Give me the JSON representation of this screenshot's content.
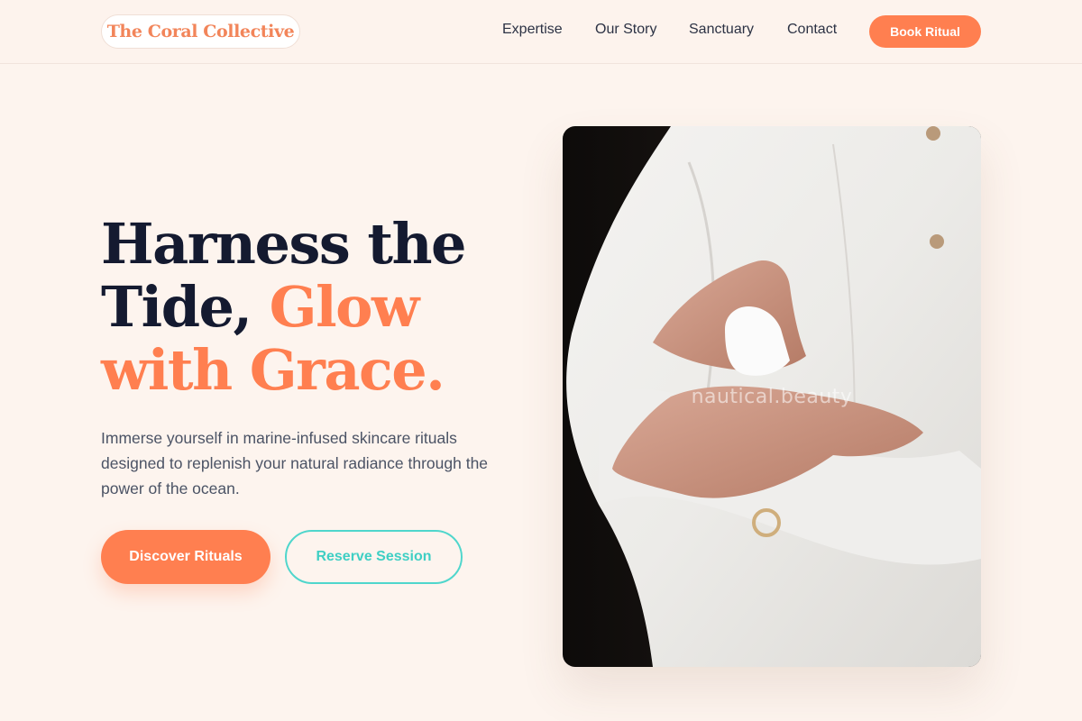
{
  "header": {
    "brand": "The Coral Collective",
    "nav": [
      "Expertise",
      "Our Story",
      "Sanctuary",
      "Contact"
    ],
    "cta": "Book Ritual"
  },
  "hero": {
    "headline_line1": "Harness the",
    "headline_line2_dark": "Tide, ",
    "headline_line2_accent": "Glow",
    "headline_line3": "with Grace.",
    "subcopy": "Immerse yourself in marine-infused skincare rituals designed to replenish your natural radiance through the power of the ocean.",
    "primary_button": "Discover Rituals",
    "secondary_button": "Reserve Session",
    "image_watermark": "nautical.beauty"
  },
  "colors": {
    "accent": "#ff7f50",
    "teal": "#4fd6cc",
    "background": "#fdf4ee",
    "heading": "#141a30"
  }
}
